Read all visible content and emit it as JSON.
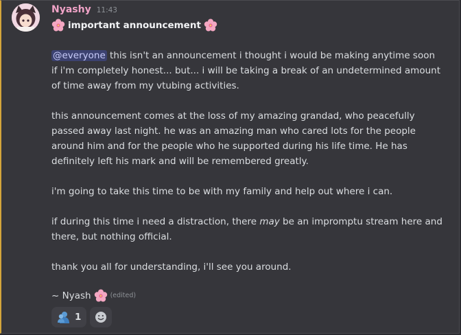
{
  "message": {
    "username": "Nyashy",
    "timestamp": "11:43",
    "subject": "important announcement",
    "mention": "@everyone",
    "para1_rest": " this isn't an announcement i thought i would be making anytime soon if i'm completely honest... but... i will be taking a break of an undetermined amount of time away from my vtubing activities.",
    "para2": "this announcement comes at the loss of my amazing grandad, who peacefully passed away last night. he was an amazing man who cared lots for the people around him and for the people who he supported during his life time. He has definitely left his mark and will be remembered greatly.",
    "para3": "i'm going to take this time to be with my family and help out where i can.",
    "para4_a": "if during this time i need a distraction, there ",
    "para4_em": "may",
    "para4_b": " be an impromptu stream here and there, but nothing official.",
    "para5": "thank you all for understanding, i'll see you around.",
    "signoff": "~ Nyash",
    "edited": "(edited)"
  },
  "reactions": [
    {
      "icon": "hug-emoji-icon",
      "count": "1"
    }
  ],
  "colors": {
    "username": "#f0a3c7",
    "mention_bg": "#3c4270",
    "accent_border": "#d4a53b",
    "background": "#36363b"
  }
}
